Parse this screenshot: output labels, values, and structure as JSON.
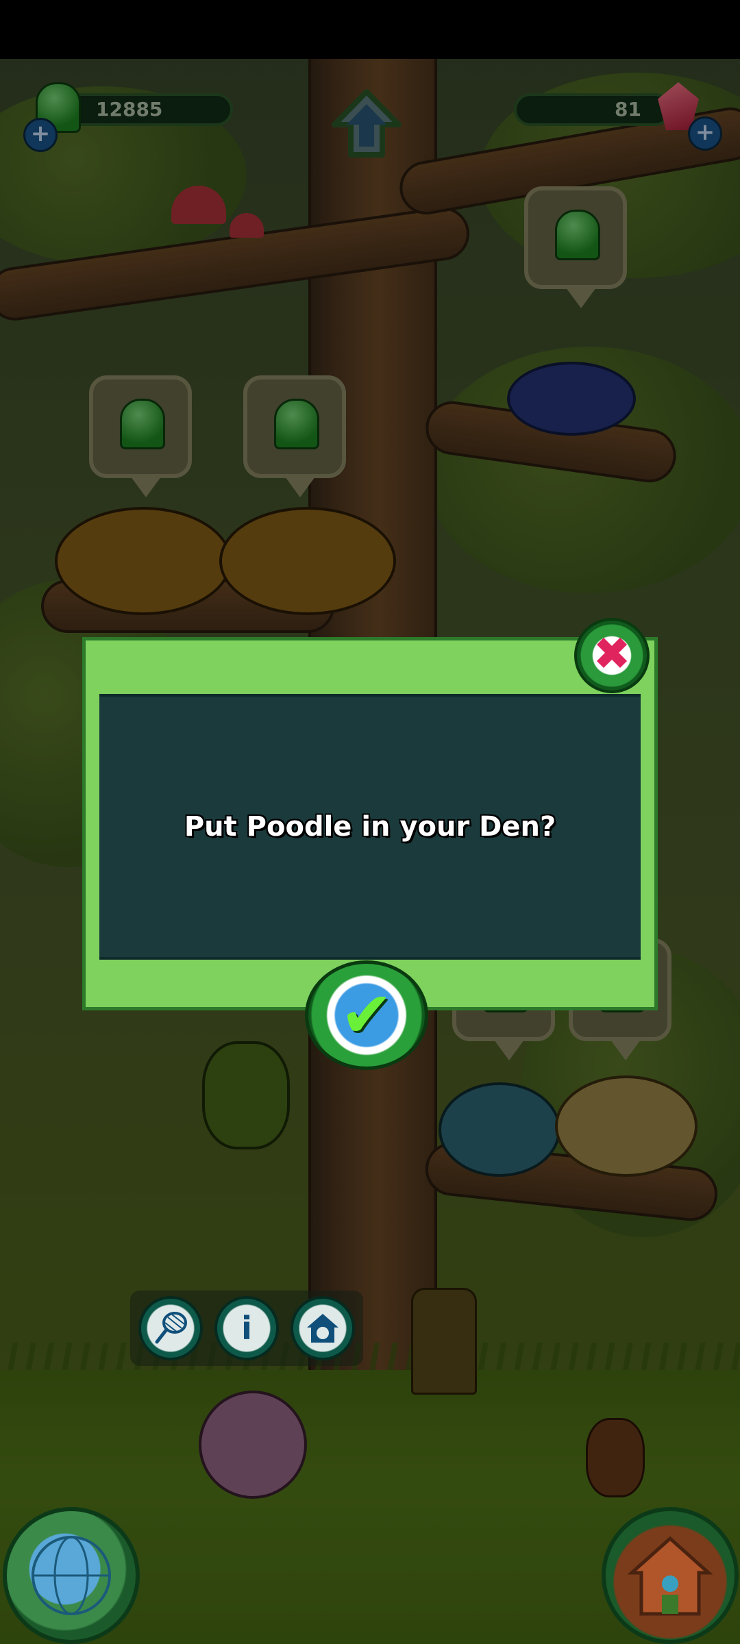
{
  "hud": {
    "gumdrops": "12885",
    "crystals": "81",
    "add_symbol": "+"
  },
  "dialog": {
    "message": "Put Poodle in your Den?",
    "close_symbol": "✖",
    "confirm_symbol": "✔"
  },
  "actions": {
    "net_icon": "net-icon",
    "info_symbol": "i",
    "den_icon": "den-icon"
  },
  "colors": {
    "dialog_frame": "#7fd25e",
    "dialog_body": "#1b3a3c",
    "close_accent": "#e0245e",
    "confirm_accent": "#6bf03a"
  }
}
